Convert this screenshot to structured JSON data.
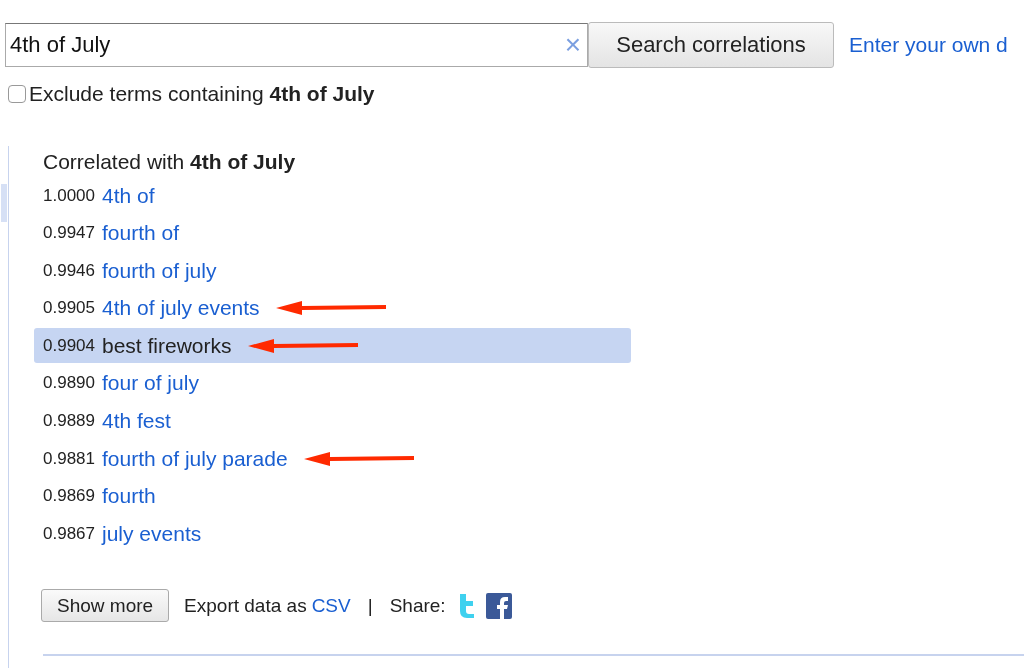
{
  "search": {
    "value": "4th of July",
    "clear": "×",
    "button": "Search correlations",
    "own_data_link": "Enter your own d"
  },
  "exclude": {
    "label": "Exclude terms containing **4th of July**",
    "checked": false
  },
  "results": {
    "title": "Correlated with **4th of July**",
    "rows": [
      {
        "score": "1.0000",
        "term": "4th of",
        "selected": false,
        "arrow": false
      },
      {
        "score": "0.9947",
        "term": "fourth of",
        "selected": false,
        "arrow": false
      },
      {
        "score": "0.9946",
        "term": "fourth of july",
        "selected": false,
        "arrow": false
      },
      {
        "score": "0.9905",
        "term": "4th of july events",
        "selected": false,
        "arrow": true
      },
      {
        "score": "0.9904",
        "term": "best fireworks",
        "selected": true,
        "arrow": true
      },
      {
        "score": "0.9890",
        "term": "four of july",
        "selected": false,
        "arrow": false
      },
      {
        "score": "0.9889",
        "term": "4th fest",
        "selected": false,
        "arrow": false
      },
      {
        "score": "0.9881",
        "term": "fourth of july parade",
        "selected": false,
        "arrow": true
      },
      {
        "score": "0.9869",
        "term": "fourth",
        "selected": false,
        "arrow": false
      },
      {
        "score": "0.9867",
        "term": "july events",
        "selected": false,
        "arrow": false
      }
    ]
  },
  "footer": {
    "show_more": "Show more",
    "export_label": "Export data as",
    "export_link": "CSV",
    "separator": "|",
    "share_label": "Share:"
  }
}
